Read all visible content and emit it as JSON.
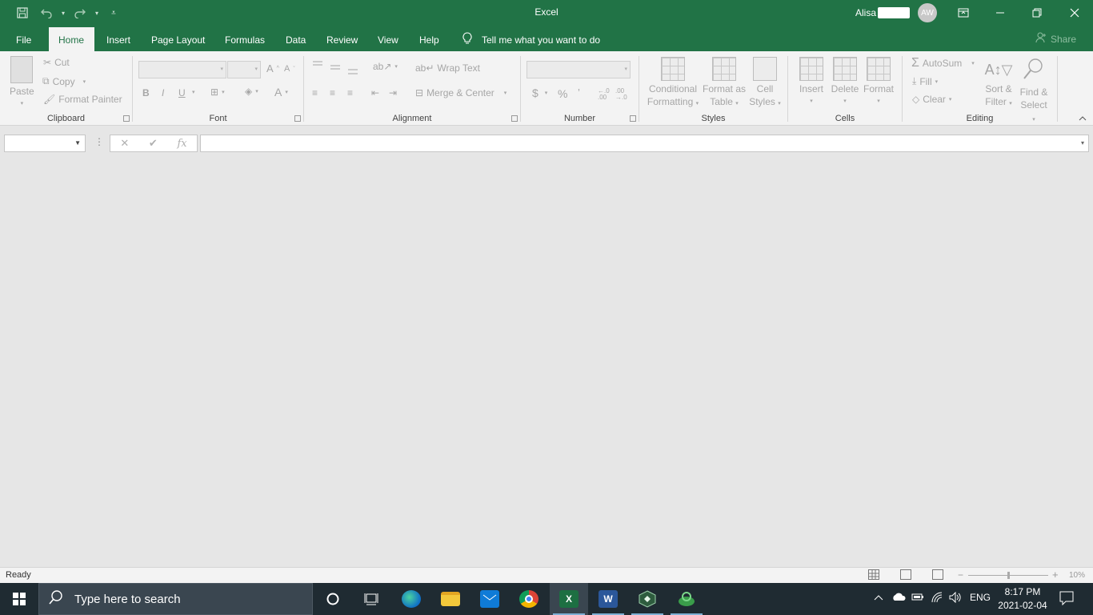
{
  "window": {
    "title": "Excel",
    "user_name": "Alisa",
    "user_initials": "AW"
  },
  "tabs": [
    "File",
    "Home",
    "Insert",
    "Page Layout",
    "Formulas",
    "Data",
    "Review",
    "View",
    "Help"
  ],
  "active_tab": "Home",
  "tell_me": "Tell me what you want to do",
  "share_label": "Share",
  "ribbon": {
    "clipboard": {
      "label": "Clipboard",
      "paste": "Paste",
      "cut": "Cut",
      "copy": "Copy",
      "format_painter": "Format Painter"
    },
    "font": {
      "label": "Font",
      "bold": "B",
      "italic": "I",
      "underline": "U",
      "grow": "A",
      "shrink": "A",
      "font_color": "A"
    },
    "alignment": {
      "label": "Alignment",
      "wrap_text": "Wrap Text",
      "merge_center": "Merge & Center"
    },
    "number": {
      "label": "Number",
      "currency": "$",
      "percent": "%",
      "comma": "’",
      "increase_decimal": "←.0 .00",
      "decrease_decimal": ".00 →.0"
    },
    "styles": {
      "label": "Styles",
      "conditional_1": "Conditional",
      "conditional_2": "Formatting",
      "format_table_1": "Format as",
      "format_table_2": "Table",
      "cell_styles_1": "Cell",
      "cell_styles_2": "Styles"
    },
    "cells": {
      "label": "Cells",
      "insert": "Insert",
      "delete": "Delete",
      "format": "Format"
    },
    "editing": {
      "label": "Editing",
      "autosum": "AutoSum",
      "fill": "Fill",
      "clear": "Clear",
      "sort_1": "Sort &",
      "sort_2": "Filter",
      "find_1": "Find &",
      "find_2": "Select"
    }
  },
  "formula_bar": {
    "name_box_value": "",
    "formula_value": "",
    "fx": "fx",
    "cancel": "✕",
    "enter": "✔"
  },
  "status_bar": {
    "status": "Ready",
    "zoom": "10%"
  },
  "taskbar": {
    "search_placeholder": "Type here to search",
    "apps": [
      {
        "name": "Microsoft Edge",
        "icon": "edge-icon"
      },
      {
        "name": "File Explorer",
        "icon": "folder-icon"
      },
      {
        "name": "Mail",
        "icon": "mail-icon"
      },
      {
        "name": "Google Chrome",
        "icon": "chrome-icon"
      },
      {
        "name": "Excel",
        "icon": "excel-icon",
        "letter": "X"
      },
      {
        "name": "Word",
        "icon": "word-icon",
        "letter": "W"
      },
      {
        "name": "App",
        "icon": "app-icon"
      },
      {
        "name": "App",
        "icon": "app2-icon"
      }
    ],
    "language": "ENG",
    "time": "8:17 PM",
    "date": "2021-02-04"
  },
  "colors": {
    "excel_green": "#217346",
    "ribbon_bg": "#f3f3f3",
    "workspace_bg": "#e6e6e6",
    "taskbar_bg": "#1f2b32"
  }
}
